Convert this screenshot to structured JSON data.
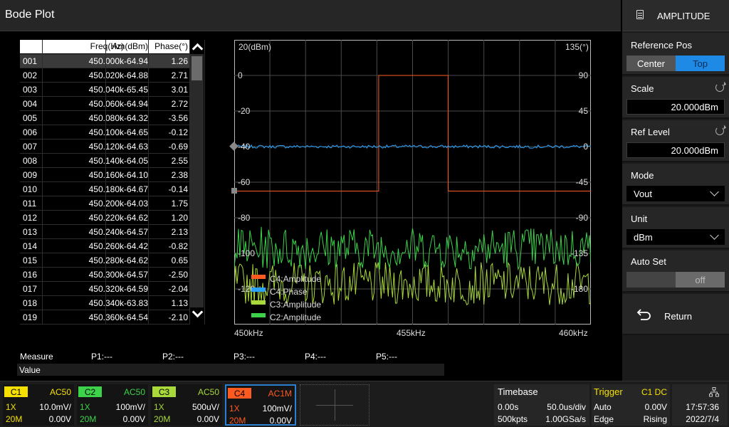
{
  "title": "Bode Plot",
  "panel": {
    "header": "AMPLITUDE",
    "header_icon": "document-icon",
    "reference_pos": {
      "label": "Reference Pos",
      "options": [
        "Center",
        "Top"
      ],
      "selected": "Top"
    },
    "scale": {
      "label": "Scale",
      "value": "20.000dBm"
    },
    "ref_level": {
      "label": "Ref Level",
      "value": "20.000dBm"
    },
    "mode": {
      "label": "Mode",
      "value": "Vout"
    },
    "unit": {
      "label": "Unit",
      "value": "dBm"
    },
    "auto_set": {
      "label": "Auto Set",
      "value": "off"
    },
    "return_label": "Return"
  },
  "table": {
    "headers": [
      "Freq(Hz)",
      "Am(dBm)",
      "Phase(°)"
    ],
    "rows": [
      [
        "001",
        "450.000k",
        "-64.94",
        "1.26"
      ],
      [
        "002",
        "450.020k",
        "-64.88",
        "2.71"
      ],
      [
        "003",
        "450.040k",
        "-65.45",
        "3.01"
      ],
      [
        "004",
        "450.060k",
        "-64.94",
        "2.72"
      ],
      [
        "005",
        "450.080k",
        "-64.32",
        "-3.56"
      ],
      [
        "006",
        "450.100k",
        "-64.65",
        "-0.12"
      ],
      [
        "007",
        "450.120k",
        "-64.63",
        "-0.69"
      ],
      [
        "008",
        "450.140k",
        "-64.05",
        "2.55"
      ],
      [
        "009",
        "450.160k",
        "-64.10",
        "2.38"
      ],
      [
        "010",
        "450.180k",
        "-64.67",
        "-0.14"
      ],
      [
        "011",
        "450.200k",
        "-64.03",
        "1.75"
      ],
      [
        "012",
        "450.220k",
        "-64.62",
        "1.20"
      ],
      [
        "013",
        "450.240k",
        "-64.57",
        "2.13"
      ],
      [
        "014",
        "450.260k",
        "-64.42",
        "-0.82"
      ],
      [
        "015",
        "450.280k",
        "-64.62",
        "0.65"
      ],
      [
        "016",
        "450.300k",
        "-64.57",
        "-2.50"
      ],
      [
        "017",
        "450.320k",
        "-64.59",
        "-2.04"
      ],
      [
        "018",
        "450.340k",
        "-63.83",
        "1.13"
      ],
      [
        "019",
        "450.360k",
        "-64.54",
        "-2.10"
      ]
    ],
    "selected_row": 0
  },
  "chart_data": {
    "type": "line",
    "left_axis_unit": "20(dBm)",
    "right_axis_unit": "135(°)",
    "left_ticks": [
      "0",
      "-20",
      "-40",
      "-60",
      "-80",
      "-100",
      "-120"
    ],
    "right_ticks": [
      "90",
      "45",
      "0",
      "-45",
      "-90",
      "-135",
      "-180"
    ],
    "x_ticks": [
      "450kHz",
      "455kHz",
      "460kHz"
    ],
    "xlim": [
      450,
      460
    ],
    "ylim_left": [
      -140,
      20
    ],
    "ylim_right": [
      -225,
      135
    ],
    "series": [
      {
        "name": "C4:Amplitude",
        "color": "#ff5a1f",
        "axis": "left",
        "x": [
          450,
          454.05,
          454.05,
          456.0,
          456.0,
          460
        ],
        "y": [
          -65,
          -65,
          0,
          0,
          -65,
          -65
        ]
      },
      {
        "name": "C4:Phase",
        "color": "#2aa3ff",
        "axis": "right",
        "noise": 2,
        "x": [
          450,
          460
        ],
        "y": [
          0,
          0
        ]
      },
      {
        "name": "C3:Amplitude",
        "color": "#a8d83a",
        "axis": "left",
        "noise": 12,
        "x": [
          450,
          460
        ],
        "y": [
          -117,
          -117
        ]
      },
      {
        "name": "C2:Amplitude",
        "color": "#3cd24a",
        "axis": "left",
        "noise": 12,
        "x": [
          450,
          460
        ],
        "y": [
          -97,
          -97
        ]
      }
    ],
    "legend_position": "bottom-left"
  },
  "measure": {
    "label": "Measure",
    "items": [
      "P1:---",
      "P2:---",
      "P3:---",
      "P4:---",
      "P5:---"
    ],
    "value_label": "Value"
  },
  "channels": [
    {
      "tag": "C1",
      "color": "#f5e000",
      "coupling": "AC50",
      "probe": "1X",
      "scale": "10.0mV/",
      "bw": "20M",
      "offset": "0.00V"
    },
    {
      "tag": "C2",
      "color": "#3cd24a",
      "coupling": "AC50",
      "probe": "1X",
      "scale": "100mV/",
      "bw": "20M",
      "offset": "0.00V"
    },
    {
      "tag": "C3",
      "color": "#a8d83a",
      "coupling": "AC50",
      "probe": "1X",
      "scale": "500uV/",
      "bw": "20M",
      "offset": "0.00V"
    },
    {
      "tag": "C4",
      "color": "#ff5a1f",
      "coupling": "AC1M",
      "probe": "1X",
      "scale": "100mV/",
      "bw": "20M",
      "offset": "0.00V"
    }
  ],
  "timebase": {
    "label": "Timebase",
    "delay": "0.00s",
    "scale": "50.0us/div",
    "points": "500kpts",
    "rate": "1.00GSa/s"
  },
  "trigger": {
    "label": "Trigger",
    "source": "C1 DC",
    "mode": "Auto",
    "level": "0.00V",
    "type": "Edge",
    "slope": "Rising"
  },
  "clock": {
    "time": "17:57:36",
    "date": "2022/7/4",
    "icon": "network-icon"
  }
}
